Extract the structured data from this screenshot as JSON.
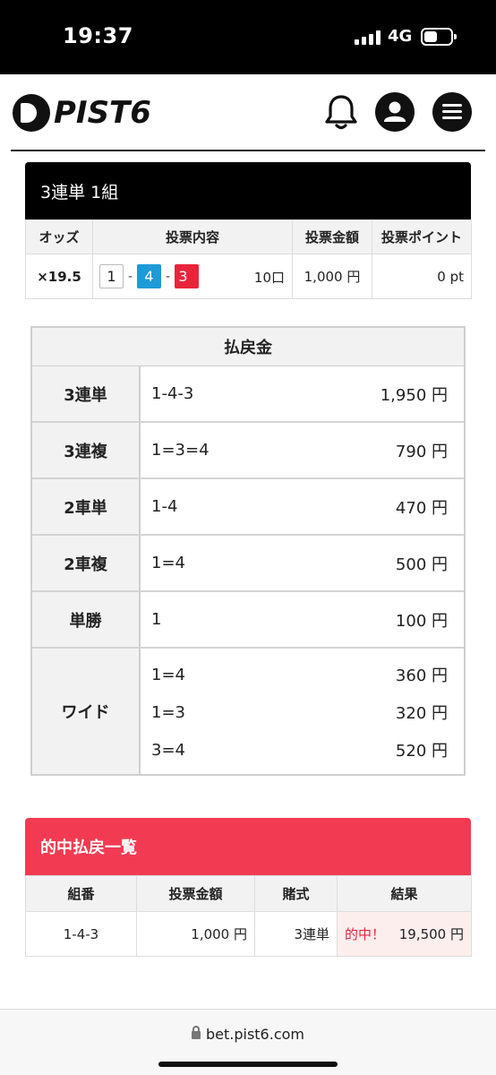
{
  "status_bar": {
    "time": "19:37",
    "network": "4G"
  },
  "header": {
    "logo_text": "PIST6"
  },
  "bet": {
    "title": "3連単 1組",
    "columns": [
      "オッズ",
      "投票内容",
      "投票金額",
      "投票ポイント"
    ],
    "odds": "×19.5",
    "combo": [
      "1",
      "4",
      "3"
    ],
    "separator": "-",
    "units": "10口",
    "amount": "1,000 円",
    "points": "0 pt"
  },
  "payout": {
    "title": "払戻金",
    "rows": [
      {
        "type": "3連単",
        "entries": [
          {
            "combo": "1-4-3",
            "amount": "1,950 円"
          }
        ]
      },
      {
        "type": "3連複",
        "entries": [
          {
            "combo": "1=3=4",
            "amount": "790 円"
          }
        ]
      },
      {
        "type": "2車単",
        "entries": [
          {
            "combo": "1-4",
            "amount": "470 円"
          }
        ]
      },
      {
        "type": "2車複",
        "entries": [
          {
            "combo": "1=4",
            "amount": "500 円"
          }
        ]
      },
      {
        "type": "単勝",
        "entries": [
          {
            "combo": "1",
            "amount": "100 円"
          }
        ]
      },
      {
        "type": "ワイド",
        "entries": [
          {
            "combo": "1=4",
            "amount": "360 円"
          },
          {
            "combo": "1=3",
            "amount": "320 円"
          },
          {
            "combo": "3=4",
            "amount": "520 円"
          }
        ]
      }
    ]
  },
  "hits": {
    "title": "的中払戻一覧",
    "columns": [
      "組番",
      "投票金額",
      "賭式",
      "結果"
    ],
    "row": {
      "combo": "1-4-3",
      "amount": "1,000 円",
      "bet_type": "3連単",
      "result_label": "的中！",
      "result_amount": "19,500 円"
    }
  },
  "footer": {
    "url": "bet.pist6.com"
  },
  "colors": {
    "accent_red": "#f23b52",
    "box_blue": "#1e9ad6",
    "box_red": "#e8243b"
  }
}
